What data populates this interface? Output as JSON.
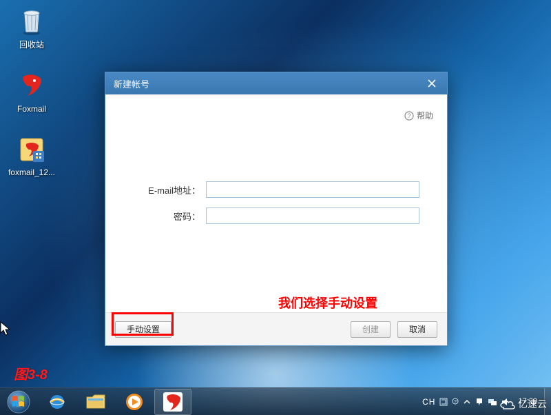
{
  "desktop": {
    "icons": [
      {
        "name": "recycle-bin",
        "label": "回收站"
      },
      {
        "name": "foxmail",
        "label": "Foxmail"
      },
      {
        "name": "foxmail-installer",
        "label": "foxmail_12..."
      }
    ]
  },
  "dialog": {
    "title": "新建帐号",
    "help_label": "帮助",
    "form": {
      "email_label": "E-mail地址：",
      "email_value": "",
      "password_label": "密码：",
      "password_value": ""
    },
    "buttons": {
      "manual_label": "手动设置",
      "create_label": "创建",
      "cancel_label": "取消"
    }
  },
  "annotation": {
    "text": "我们选择手动设置",
    "figure_label": "图3-8"
  },
  "taskbar": {
    "ime": "CH",
    "time": "17:29",
    "date": ""
  },
  "watermark": {
    "text": "亿速云"
  },
  "colors": {
    "annotation_red": "#ff0000",
    "dialog_title_bg": "#3f7fb8"
  }
}
